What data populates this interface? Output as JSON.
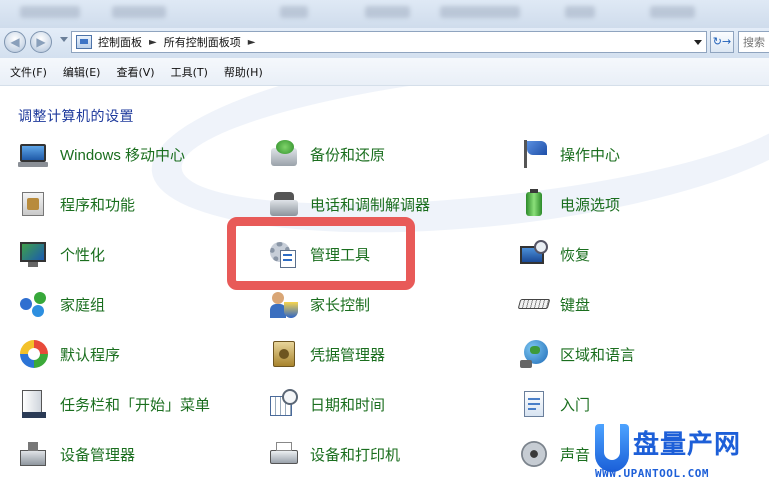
{
  "address_bar": {
    "breadcrumbs": [
      "控制面板",
      "所有控制面板项"
    ]
  },
  "search": {
    "placeholder": "搜索"
  },
  "menu": [
    {
      "label": "文件(F)"
    },
    {
      "label": "编辑(E)"
    },
    {
      "label": "查看(V)"
    },
    {
      "label": "工具(T)"
    },
    {
      "label": "帮助(H)"
    }
  ],
  "page_title": "调整计算机的设置",
  "items": [
    {
      "label": "Windows 移动中心",
      "icon": "mobility-center-icon"
    },
    {
      "label": "备份和还原",
      "icon": "backup-restore-icon"
    },
    {
      "label": "操作中心",
      "icon": "action-center-flag-icon"
    },
    {
      "label": "程序和功能",
      "icon": "programs-features-icon"
    },
    {
      "label": "电话和调制解调器",
      "icon": "phone-modem-icon"
    },
    {
      "label": "电源选项",
      "icon": "power-options-icon"
    },
    {
      "label": "个性化",
      "icon": "personalization-icon"
    },
    {
      "label": "管理工具",
      "icon": "admin-tools-icon"
    },
    {
      "label": "恢复",
      "icon": "recovery-icon"
    },
    {
      "label": "家庭组",
      "icon": "homegroup-icon"
    },
    {
      "label": "家长控制",
      "icon": "parental-controls-icon"
    },
    {
      "label": "键盘",
      "icon": "keyboard-icon"
    },
    {
      "label": "默认程序",
      "icon": "default-programs-icon"
    },
    {
      "label": "凭据管理器",
      "icon": "credential-manager-icon"
    },
    {
      "label": "区域和语言",
      "icon": "region-language-globe-icon"
    },
    {
      "label": "任务栏和「开始」菜单",
      "icon": "taskbar-start-menu-icon"
    },
    {
      "label": "日期和时间",
      "icon": "date-time-icon"
    },
    {
      "label": "入门",
      "icon": "getting-started-icon"
    },
    {
      "label": "设备管理器",
      "icon": "device-manager-icon"
    },
    {
      "label": "设备和打印机",
      "icon": "devices-printers-icon"
    },
    {
      "label": "声音",
      "icon": "sound-icon"
    }
  ],
  "watermark": {
    "brand": "盘量产网",
    "url": "WWW.UPANTOOL.COM"
  },
  "colors": {
    "item_label": "#1a6e1e",
    "title": "#1e3a9c",
    "highlight": "#e85a58",
    "logo": "#1d5fd8"
  }
}
